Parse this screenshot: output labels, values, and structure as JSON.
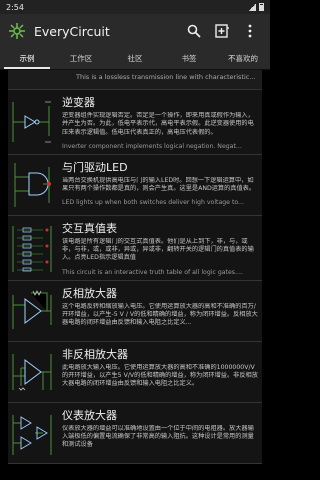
{
  "status": {
    "time": "2:54"
  },
  "app": {
    "title": "EveryCircuit"
  },
  "tabs": [
    {
      "label": "示例"
    },
    {
      "label": "工作区"
    },
    {
      "label": "社区"
    },
    {
      "label": "书签"
    },
    {
      "label": "不喜欢的"
    }
  ],
  "partial_text": "This is a lossless transmission line with characteristic...",
  "cards": [
    {
      "title": "逆变器",
      "desc": "逆变器组件实现逻辑否定。否定是一个操作，即来用真或假作为输入，并产生为否。为此，低电平表示代，高电平表示假。此逆变器使用的电压来表示逻辑值。低电压代表真正的，高电压代表假的。",
      "desc_en": "Inverter component implements logical negation. Negat..."
    },
    {
      "title": "与门驱动LED",
      "desc": "当两台交换机提供高电压与门的输入LED时。回想一下逻辑运算中，如果只有两个操作数都是真的，则会产生真。这里是AND运算的真值表。",
      "desc_en": "LED lights up when both switches deliver high voltage to..."
    },
    {
      "title": "交互真值表",
      "desc": "该电路是所有逻辑门的交互式真值表。他们是从上到下，非，与，或非，与非，或，或非，异或，异或非，翻转开关的逻辑门的真值表的输入。点亮LED指示逻辑真值",
      "desc_en": "This circuit is an interactive truth table of all logic gates...."
    },
    {
      "title": "反相放大器",
      "desc": "这个电路反转和缩放输入电压。它使用运算放大器的高和不准确的百万/开环增益，以产生-5 V / V的低和精确的增益，称为闭环增益。反相放大器电路的闭环增益由反馈和输入电阻之比定义...",
      "desc_en": ""
    },
    {
      "title": "非反相放大器",
      "desc": "此电路放大输入电压。它使用运算放大器的高和不准确的1000000V/V的开环增益，以产生5 V/V的低和精确的增益，称为闭环增益。非反相放大器电路的闭环增益由反馈和输入电阻之比定义。",
      "desc_en": ""
    },
    {
      "title": "仪表放大器",
      "desc": "仪表放大器的增益可以准确地设置由一个位于中间的电阻器。放大器输入端极低的偏置电流确保了非常高的输入阻抗。这种设计是常用的测量和测试设备",
      "desc_en": ""
    }
  ],
  "icons": {
    "logo": "circuit-logo-icon",
    "search": "search-icon",
    "add": "add-circuit-icon",
    "menu": "overflow-menu-icon"
  },
  "colors": {
    "appbar": "#2a2a2a",
    "background": "#000000",
    "wire": "#4a8f3a",
    "logo": "#6ec04a"
  }
}
